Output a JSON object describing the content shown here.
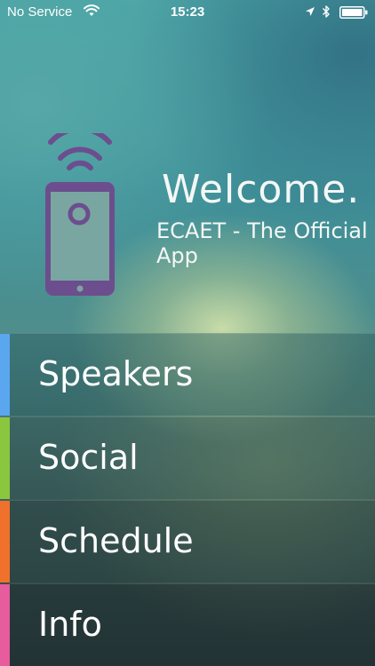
{
  "status_bar": {
    "carrier": "No Service",
    "time": "15:23"
  },
  "hero": {
    "title": "Welcome.",
    "subtitle": "ECAET - The Official App",
    "icon_color": "#6c4e8e"
  },
  "menu": {
    "items": [
      {
        "label": "Speakers",
        "accent": "#5aa7f0"
      },
      {
        "label": "Social",
        "accent": "#8bc63f"
      },
      {
        "label": "Schedule",
        "accent": "#f0712c"
      },
      {
        "label": "Info",
        "accent": "#e65c9c"
      }
    ],
    "item_bgs": [
      "rgba(40,90,95,0.45)",
      "rgba(45,80,80,0.40)",
      "rgba(35,60,60,0.45)",
      "rgba(25,40,42,0.50)"
    ]
  }
}
